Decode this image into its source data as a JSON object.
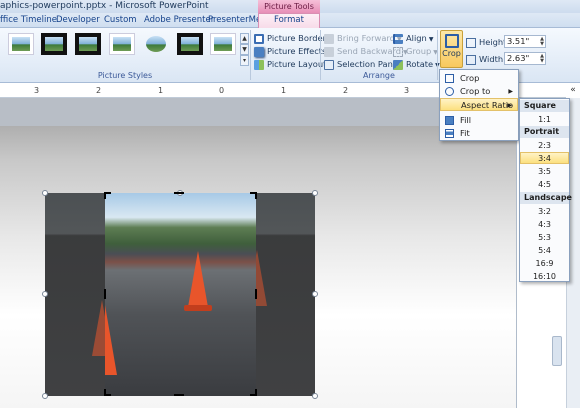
{
  "window": {
    "title": "aphics-powerpoint.pptx - Microsoft PowerPoint",
    "contextual_tab_group": "Picture Tools"
  },
  "tabs": [
    "ffice Timeline",
    "Developer",
    "Custom",
    "Adobe Presenter",
    "PresenterMedia",
    "Format"
  ],
  "ribbon": {
    "picture_styles_label": "Picture Styles",
    "arrange_label": "Arrange",
    "adjust": {
      "picture_border": "Picture Border",
      "picture_effects": "Picture Effects",
      "picture_layout": "Picture Layout"
    },
    "arrange": {
      "bring_forward": "Bring Forward",
      "send_backward": "Send Backward",
      "selection_pane": "Selection Pane",
      "align": "Align",
      "group": "Group",
      "rotate": "Rotate"
    },
    "size": {
      "crop_label": "Crop",
      "height_label": "Height:",
      "height_value": "3.51\"",
      "width_label": "Width:",
      "width_value": "2.63\""
    }
  },
  "ruler_numbers": [
    "3",
    "2",
    "1",
    "0",
    "1",
    "2",
    "3"
  ],
  "crop_menu": {
    "items": [
      {
        "label": "Crop",
        "icon": "crop-icon"
      },
      {
        "label": "Crop to Shape",
        "icon": "shape-icon",
        "submenu": true
      },
      {
        "label": "Aspect Ratio",
        "icon": "",
        "submenu": true,
        "highlighted": true
      },
      {
        "label": "Fill",
        "icon": "fill-icon"
      },
      {
        "label": "Fit",
        "icon": "fit-icon"
      }
    ]
  },
  "aspect_submenu": {
    "square_header": "Square",
    "square": [
      "1:1"
    ],
    "portrait_header": "Portrait",
    "portrait": [
      "2:3",
      "3:4",
      "3:5",
      "4:5"
    ],
    "landscape_header": "Landscape",
    "landscape": [
      "3:2",
      "4:3",
      "5:3",
      "5:4",
      "16:9",
      "16:10"
    ],
    "highlighted": "3:4"
  }
}
